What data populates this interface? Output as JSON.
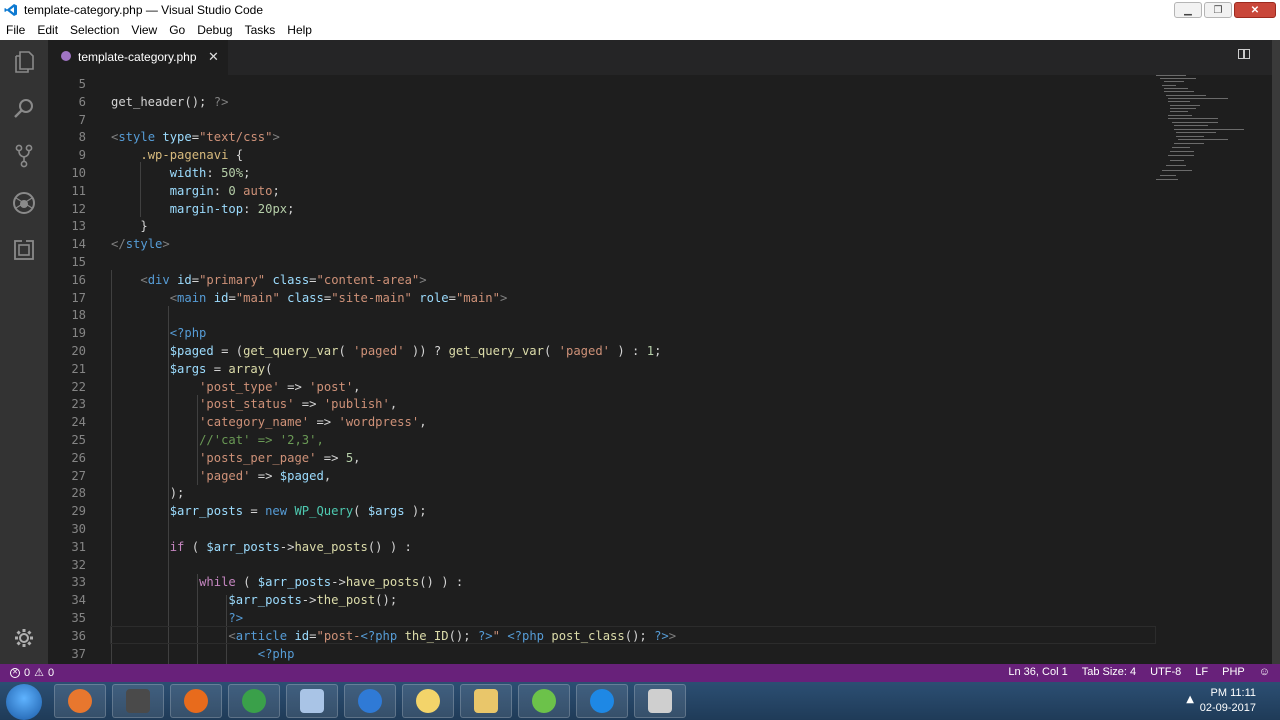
{
  "window": {
    "title": "template-category.php — Visual Studio Code"
  },
  "menu": [
    "File",
    "Edit",
    "Selection",
    "View",
    "Go",
    "Debug",
    "Tasks",
    "Help"
  ],
  "tab": {
    "label": "template-category.php",
    "close": "✕"
  },
  "code_lines": [
    {
      "n": "5",
      "tokens": []
    },
    {
      "n": "6",
      "tokens": [
        [
          "txt",
          "get_header(); "
        ],
        [
          "tag",
          "?>"
        ]
      ]
    },
    {
      "n": "7",
      "tokens": []
    },
    {
      "n": "8",
      "tokens": [
        [
          "tag",
          "<"
        ],
        [
          "tn",
          "style"
        ],
        [
          "txt",
          " "
        ],
        [
          "an",
          "type"
        ],
        [
          "txt",
          "="
        ],
        [
          "str",
          "\"text/css\""
        ],
        [
          "tag",
          ">"
        ]
      ]
    },
    {
      "n": "9",
      "tokens": [
        [
          "txt",
          "    "
        ],
        [
          "sel",
          ".wp-pagenavi"
        ],
        [
          "txt",
          " {"
        ]
      ]
    },
    {
      "n": "10",
      "tokens": [
        [
          "txt",
          "        "
        ],
        [
          "prop",
          "width"
        ],
        [
          "txt",
          ": "
        ],
        [
          "num",
          "50%"
        ],
        [
          "txt",
          ";"
        ]
      ]
    },
    {
      "n": "11",
      "tokens": [
        [
          "txt",
          "        "
        ],
        [
          "prop",
          "margin"
        ],
        [
          "txt",
          ": "
        ],
        [
          "num",
          "0"
        ],
        [
          "txt",
          " "
        ],
        [
          "str",
          "auto"
        ],
        [
          "txt",
          ";"
        ]
      ]
    },
    {
      "n": "12",
      "tokens": [
        [
          "txt",
          "        "
        ],
        [
          "prop",
          "margin-top"
        ],
        [
          "txt",
          ": "
        ],
        [
          "num",
          "20px"
        ],
        [
          "txt",
          ";"
        ]
      ]
    },
    {
      "n": "13",
      "tokens": [
        [
          "txt",
          "    }"
        ]
      ]
    },
    {
      "n": "14",
      "tokens": [
        [
          "tag",
          "</"
        ],
        [
          "tn",
          "style"
        ],
        [
          "tag",
          ">"
        ]
      ]
    },
    {
      "n": "15",
      "tokens": []
    },
    {
      "n": "16",
      "tokens": [
        [
          "txt",
          "    "
        ],
        [
          "tag",
          "<"
        ],
        [
          "tn",
          "div"
        ],
        [
          "txt",
          " "
        ],
        [
          "an",
          "id"
        ],
        [
          "txt",
          "="
        ],
        [
          "str",
          "\"primary\""
        ],
        [
          "txt",
          " "
        ],
        [
          "an",
          "class"
        ],
        [
          "txt",
          "="
        ],
        [
          "str",
          "\"content-area\""
        ],
        [
          "tag",
          ">"
        ]
      ]
    },
    {
      "n": "17",
      "tokens": [
        [
          "txt",
          "        "
        ],
        [
          "tag",
          "<"
        ],
        [
          "tn",
          "main"
        ],
        [
          "txt",
          " "
        ],
        [
          "an",
          "id"
        ],
        [
          "txt",
          "="
        ],
        [
          "str",
          "\"main\""
        ],
        [
          "txt",
          " "
        ],
        [
          "an",
          "class"
        ],
        [
          "txt",
          "="
        ],
        [
          "str",
          "\"site-main\""
        ],
        [
          "txt",
          " "
        ],
        [
          "an",
          "role"
        ],
        [
          "txt",
          "="
        ],
        [
          "str",
          "\"main\""
        ],
        [
          "tag",
          ">"
        ]
      ]
    },
    {
      "n": "18",
      "tokens": []
    },
    {
      "n": "19",
      "tokens": [
        [
          "txt",
          "        "
        ],
        [
          "kw2",
          "<?php"
        ]
      ]
    },
    {
      "n": "20",
      "tokens": [
        [
          "txt",
          "        "
        ],
        [
          "var",
          "$paged"
        ],
        [
          "txt",
          " = ("
        ],
        [
          "fn",
          "get_query_var"
        ],
        [
          "txt",
          "( "
        ],
        [
          "str",
          "'paged'"
        ],
        [
          "txt",
          " )) ? "
        ],
        [
          "fn",
          "get_query_var"
        ],
        [
          "txt",
          "( "
        ],
        [
          "str",
          "'paged'"
        ],
        [
          "txt",
          " ) : "
        ],
        [
          "num",
          "1"
        ],
        [
          "txt",
          ";"
        ]
      ]
    },
    {
      "n": "21",
      "tokens": [
        [
          "txt",
          "        "
        ],
        [
          "var",
          "$args"
        ],
        [
          "txt",
          " = "
        ],
        [
          "fn",
          "array"
        ],
        [
          "txt",
          "("
        ]
      ]
    },
    {
      "n": "22",
      "tokens": [
        [
          "txt",
          "            "
        ],
        [
          "str",
          "'post_type'"
        ],
        [
          "txt",
          " => "
        ],
        [
          "str",
          "'post'"
        ],
        [
          "txt",
          ","
        ]
      ]
    },
    {
      "n": "23",
      "tokens": [
        [
          "txt",
          "            "
        ],
        [
          "str",
          "'post_status'"
        ],
        [
          "txt",
          " => "
        ],
        [
          "str",
          "'publish'"
        ],
        [
          "txt",
          ","
        ]
      ]
    },
    {
      "n": "24",
      "tokens": [
        [
          "txt",
          "            "
        ],
        [
          "str",
          "'category_name'"
        ],
        [
          "txt",
          " => "
        ],
        [
          "str",
          "'wordpress'"
        ],
        [
          "txt",
          ","
        ]
      ]
    },
    {
      "n": "25",
      "tokens": [
        [
          "txt",
          "            "
        ],
        [
          "cmt",
          "//'cat' => '2,3',"
        ]
      ]
    },
    {
      "n": "26",
      "tokens": [
        [
          "txt",
          "            "
        ],
        [
          "str",
          "'posts_per_page'"
        ],
        [
          "txt",
          " => "
        ],
        [
          "num",
          "5"
        ],
        [
          "txt",
          ","
        ]
      ]
    },
    {
      "n": "27",
      "tokens": [
        [
          "txt",
          "            "
        ],
        [
          "str",
          "'paged'"
        ],
        [
          "txt",
          " => "
        ],
        [
          "var",
          "$paged"
        ],
        [
          "txt",
          ","
        ]
      ]
    },
    {
      "n": "28",
      "tokens": [
        [
          "txt",
          "        );"
        ]
      ]
    },
    {
      "n": "29",
      "tokens": [
        [
          "txt",
          "        "
        ],
        [
          "var",
          "$arr_posts"
        ],
        [
          "txt",
          " = "
        ],
        [
          "kw2",
          "new"
        ],
        [
          "txt",
          " "
        ],
        [
          "cls",
          "WP_Query"
        ],
        [
          "txt",
          "( "
        ],
        [
          "var",
          "$args"
        ],
        [
          "txt",
          " );"
        ]
      ]
    },
    {
      "n": "30",
      "tokens": []
    },
    {
      "n": "31",
      "tokens": [
        [
          "txt",
          "        "
        ],
        [
          "kw",
          "if"
        ],
        [
          "txt",
          " ( "
        ],
        [
          "var",
          "$arr_posts"
        ],
        [
          "txt",
          "->"
        ],
        [
          "fn",
          "have_posts"
        ],
        [
          "txt",
          "() ) :"
        ]
      ]
    },
    {
      "n": "32",
      "tokens": []
    },
    {
      "n": "33",
      "tokens": [
        [
          "txt",
          "            "
        ],
        [
          "kw",
          "while"
        ],
        [
          "txt",
          " ( "
        ],
        [
          "var",
          "$arr_posts"
        ],
        [
          "txt",
          "->"
        ],
        [
          "fn",
          "have_posts"
        ],
        [
          "txt",
          "() ) :"
        ]
      ]
    },
    {
      "n": "34",
      "tokens": [
        [
          "txt",
          "                "
        ],
        [
          "var",
          "$arr_posts"
        ],
        [
          "txt",
          "->"
        ],
        [
          "fn",
          "the_post"
        ],
        [
          "txt",
          "();"
        ]
      ]
    },
    {
      "n": "35",
      "tokens": [
        [
          "txt",
          "                "
        ],
        [
          "kw2",
          "?>"
        ]
      ]
    },
    {
      "n": "36",
      "tokens": [
        [
          "txt",
          "                "
        ],
        [
          "tag",
          "<"
        ],
        [
          "tn",
          "article"
        ],
        [
          "txt",
          " "
        ],
        [
          "an",
          "id"
        ],
        [
          "txt",
          "="
        ],
        [
          "str",
          "\"post-"
        ],
        [
          "kw2",
          "<?php"
        ],
        [
          "txt",
          " "
        ],
        [
          "fn",
          "the_ID"
        ],
        [
          "txt",
          "(); "
        ],
        [
          "kw2",
          "?>"
        ],
        [
          "str",
          "\""
        ],
        [
          "txt",
          " "
        ],
        [
          "kw2",
          "<?php"
        ],
        [
          "txt",
          " "
        ],
        [
          "fn",
          "post_class"
        ],
        [
          "txt",
          "(); "
        ],
        [
          "kw2",
          "?>"
        ],
        [
          "tag",
          ">"
        ]
      ]
    },
    {
      "n": "37",
      "tokens": [
        [
          "txt",
          "                    "
        ],
        [
          "kw2",
          "<?php"
        ]
      ]
    }
  ],
  "colors": {
    "tag": "#808080",
    "tn": "#569cd6",
    "an": "#9cdcfe",
    "str": "#ce9178",
    "kw": "#c586c0",
    "kw2": "#569cd6",
    "fn": "#dcdcaa",
    "var": "#9cdcfe",
    "num": "#b5cea8",
    "cmt": "#6a9955",
    "cls": "#4ec9b0",
    "sel": "#d7ba7d",
    "prop": "#9cdcfe",
    "txt": "#d4d4d4",
    "status_bar": "#68217a"
  },
  "statusbar": {
    "errors": "0",
    "warnings": "0",
    "position": "Ln 36, Col 1",
    "tab_size": "Tab Size: 4",
    "encoding": "UTF-8",
    "eol": "LF",
    "language": "PHP"
  },
  "taskbar": {
    "apps": [
      "media-player-icon",
      "sublime-text-icon",
      "firefox-icon",
      "chrome-icon",
      "file-manager-icon",
      "internet-explorer-icon",
      "folder-icon",
      "file-explorer-icon",
      "chat-icon",
      "vscode-icon",
      "window-icon"
    ],
    "time": "PM 11:11",
    "date": "02-09-2017"
  }
}
